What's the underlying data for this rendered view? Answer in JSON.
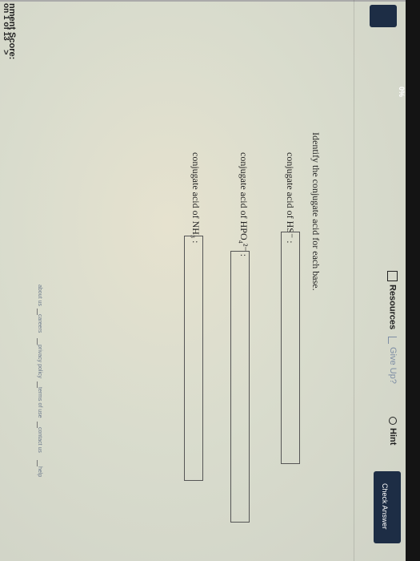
{
  "score": {
    "label": "nment Score:",
    "value": "0%"
  },
  "question_nav": {
    "label": "on 1 of 13",
    "next": ">"
  },
  "toolbar": {
    "resources": "Resources",
    "give_up": "Give Up?",
    "hint": "Hint",
    "check_answer": "Check Answer"
  },
  "question": {
    "prompt": "Identify the conjugate acid for each base.",
    "items": [
      {
        "label": "conjugate acid of HS⁻ :",
        "value": ""
      },
      {
        "label": "conjugate acid of HPO₄²⁻ :",
        "value": ""
      },
      {
        "label": "conjugate acid of NH₃ :",
        "value": ""
      }
    ]
  },
  "footer": {
    "links": [
      "about us",
      "careers",
      "privacy policy",
      "terms of use",
      "contact us",
      "help"
    ]
  }
}
